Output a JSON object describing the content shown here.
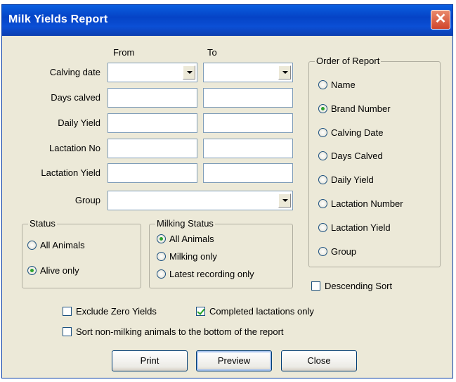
{
  "window": {
    "title": "Milk Yields Report",
    "close_glyph": "✕"
  },
  "columns": {
    "from": "From",
    "to": "To"
  },
  "filters": {
    "calving_date": "Calving date",
    "days_calved": "Days calved",
    "daily_yield": "Daily Yield",
    "lactation_no": "Lactation No",
    "lactation_yield": "Lactation Yield",
    "group": "Group"
  },
  "status": {
    "title": "Status",
    "options": [
      "All Animals",
      "Alive only"
    ],
    "selected": "Alive only"
  },
  "milking_status": {
    "title": "Milking Status",
    "options": [
      "All Animals",
      "Milking only",
      "Latest recording only"
    ],
    "selected": "All Animals"
  },
  "order": {
    "title": "Order of Report",
    "options": [
      "Name",
      "Brand Number",
      "Calving Date",
      "Days Calved",
      "Daily Yield",
      "Lactation Number",
      "Lactation Yield",
      "Group"
    ],
    "selected": "Brand Number"
  },
  "checkboxes": {
    "descending_sort": {
      "label": "Descending Sort",
      "checked": false
    },
    "exclude_zero": {
      "label": "Exclude Zero Yields",
      "checked": false
    },
    "completed_lactations": {
      "label": "Completed lactations only",
      "checked": true
    },
    "sort_non_milking": {
      "label": "Sort non-milking animals to the bottom of the report",
      "checked": false
    }
  },
  "buttons": {
    "print": "Print",
    "preview": "Preview",
    "close": "Close"
  },
  "colors": {
    "titlebar": "#0543c6",
    "dialog_bg": "#ece9d8",
    "field_border": "#7f9db9"
  }
}
